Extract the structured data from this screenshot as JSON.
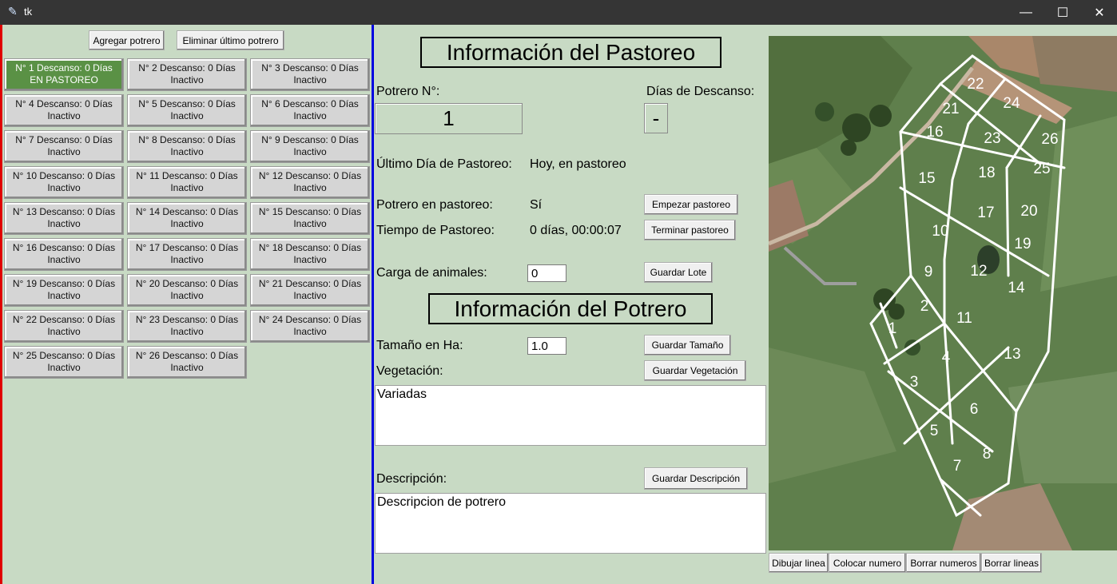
{
  "window": {
    "title": "tk",
    "minimize_glyph": "—",
    "maximize_glyph": "☐",
    "close_glyph": "✕"
  },
  "left": {
    "add_button": "Agregar potrero",
    "remove_button": "Eliminar último potrero",
    "paddocks": [
      {
        "line1": "N° 1  Descanso: 0 Días",
        "line2": "EN PASTOREO",
        "active": true
      },
      {
        "line1": "N° 2  Descanso: 0 Días",
        "line2": "Inactivo",
        "active": false
      },
      {
        "line1": "N° 3  Descanso: 0 Días",
        "line2": "Inactivo",
        "active": false
      },
      {
        "line1": "N° 4  Descanso: 0 Días",
        "line2": "Inactivo",
        "active": false
      },
      {
        "line1": "N° 5  Descanso: 0 Días",
        "line2": "Inactivo",
        "active": false
      },
      {
        "line1": "N° 6  Descanso: 0 Días",
        "line2": "Inactivo",
        "active": false
      },
      {
        "line1": "N° 7  Descanso: 0 Días",
        "line2": "Inactivo",
        "active": false
      },
      {
        "line1": "N° 8  Descanso: 0 Días",
        "line2": "Inactivo",
        "active": false
      },
      {
        "line1": "N° 9  Descanso: 0 Días",
        "line2": "Inactivo",
        "active": false
      },
      {
        "line1": "N° 10  Descanso: 0 Días",
        "line2": "Inactivo",
        "active": false
      },
      {
        "line1": "N° 11  Descanso: 0 Días",
        "line2": "Inactivo",
        "active": false
      },
      {
        "line1": "N° 12  Descanso: 0 Días",
        "line2": "Inactivo",
        "active": false
      },
      {
        "line1": "N° 13  Descanso: 0 Días",
        "line2": "Inactivo",
        "active": false
      },
      {
        "line1": "N° 14  Descanso: 0 Días",
        "line2": "Inactivo",
        "active": false
      },
      {
        "line1": "N° 15  Descanso: 0 Días",
        "line2": "Inactivo",
        "active": false
      },
      {
        "line1": "N° 16  Descanso: 0 Días",
        "line2": "Inactivo",
        "active": false
      },
      {
        "line1": "N° 17  Descanso: 0 Días",
        "line2": "Inactivo",
        "active": false
      },
      {
        "line1": "N° 18  Descanso: 0 Días",
        "line2": "Inactivo",
        "active": false
      },
      {
        "line1": "N° 19  Descanso: 0 Días",
        "line2": "Inactivo",
        "active": false
      },
      {
        "line1": "N° 20  Descanso: 0 Días",
        "line2": "Inactivo",
        "active": false
      },
      {
        "line1": "N° 21  Descanso: 0 Días",
        "line2": "Inactivo",
        "active": false
      },
      {
        "line1": "N° 22  Descanso: 0 Días",
        "line2": "Inactivo",
        "active": false
      },
      {
        "line1": "N° 23  Descanso: 0 Días",
        "line2": "Inactivo",
        "active": false
      },
      {
        "line1": "N° 24  Descanso: 0 Días",
        "line2": "Inactivo",
        "active": false
      },
      {
        "line1": "N° 25  Descanso: 0 Días",
        "line2": "Inactivo",
        "active": false
      },
      {
        "line1": "N° 26  Descanso: 0 Días",
        "line2": "Inactivo",
        "active": false
      }
    ]
  },
  "grazing": {
    "title": "Información del Pastoreo",
    "paddock_label": "Potrero N°:",
    "paddock_value": "1",
    "rest_label": "Días de Descanso:",
    "rest_value": "-",
    "last_day_label": "Último Día de Pastoreo:",
    "last_day_value": "Hoy, en pastoreo",
    "in_grazing_label": "Potrero en pastoreo:",
    "in_grazing_value": "Sí",
    "start_button": "Empezar pastoreo",
    "time_label": "Tiempo de Pastoreo:",
    "time_value": "0 días, 00:00:07",
    "end_button": "Terminar pastoreo",
    "load_label": "Carga de animales:",
    "load_value": "0",
    "save_lot_button": "Guardar Lote"
  },
  "paddock_info": {
    "title": "Información del Potrero",
    "size_label": "Tamaño en Ha:",
    "size_value": "1.0",
    "save_size_button": "Guardar Tamaño",
    "veg_label": "Vegetación:",
    "save_veg_button": "Guardar Vegetación",
    "veg_text": "Variadas",
    "desc_label": "Descripción:",
    "save_desc_button": "Guardar Descripción",
    "desc_text": "Descripcion de potrero"
  },
  "map": {
    "numbers": [
      "1",
      "2",
      "3",
      "4",
      "5",
      "6",
      "7",
      "8",
      "9",
      "10",
      "11",
      "12",
      "13",
      "14",
      "15",
      "16",
      "17",
      "18",
      "19",
      "20",
      "21",
      "22",
      "23",
      "24",
      "25",
      "26"
    ],
    "buttons": {
      "draw_line": "Dibujar linea",
      "place_number": "Colocar numero",
      "clear_numbers": "Borrar numeros",
      "clear_lines": "Borrar lineas"
    }
  }
}
